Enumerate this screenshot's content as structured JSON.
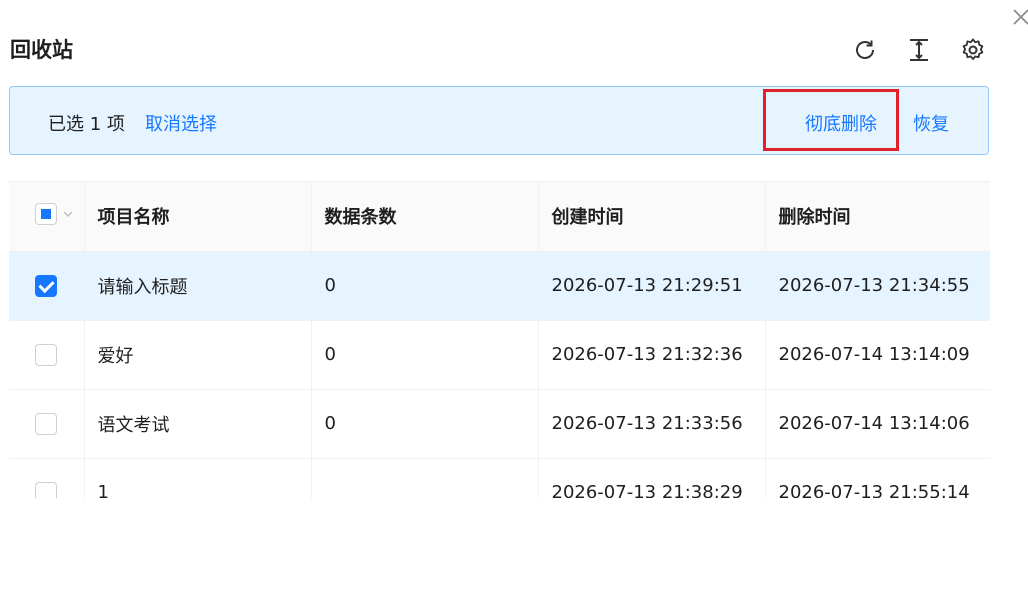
{
  "dialog": {
    "title": "回收站"
  },
  "selection_bar": {
    "count_text": "已选 1 项",
    "cancel_label": "取消选择",
    "delete_label": "彻底删除",
    "restore_label": "恢复"
  },
  "table": {
    "columns": [
      "项目名称",
      "数据条数",
      "创建时间",
      "删除时间"
    ],
    "rows": [
      {
        "name": "请输入标题",
        "count": "0",
        "created": "2026-07-13 21:29:51",
        "deleted": "2026-07-13 21:34:55",
        "checked": true
      },
      {
        "name": "爱好",
        "count": "0",
        "created": "2026-07-13 21:32:36",
        "deleted": "2026-07-14 13:14:09",
        "checked": false
      },
      {
        "name": "语文考试",
        "count": "0",
        "created": "2026-07-13 21:33:56",
        "deleted": "2026-07-14 13:14:06",
        "checked": false
      },
      {
        "name": "1",
        "count": "",
        "created": "2026-07-13 21:38:29",
        "deleted": "2026-07-13 21:55:14",
        "checked": false
      }
    ]
  },
  "colors": {
    "accent": "#1677ff",
    "selected_row_bg": "#e6f4ff",
    "highlight_border": "#e0202a"
  },
  "icons": {
    "close": "close-icon",
    "refresh": "refresh-icon",
    "row_height": "column-height-icon",
    "settings": "gear-icon"
  }
}
